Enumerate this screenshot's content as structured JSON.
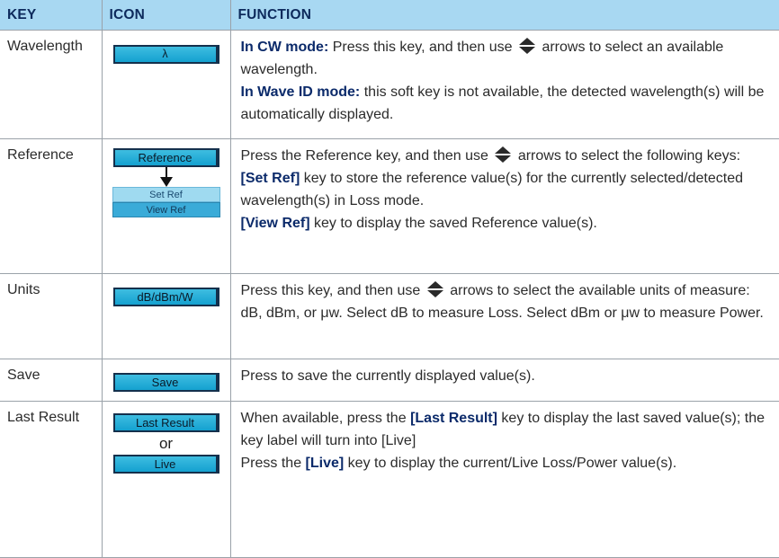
{
  "header": {
    "key": "KEY",
    "icon": "ICON",
    "function": "FUNCTION"
  },
  "colors": {
    "header_bg": "#a8d8f2",
    "header_text": "#0d2a5c",
    "softkey": "#1fa8d6",
    "border": "#9aa2a9"
  },
  "rows": [
    {
      "key": "Wavelength",
      "icon": {
        "button": "λ"
      },
      "function": {
        "p1_bold": "In CW mode:",
        "p1_a": "Press this key, and then use",
        "p1_b": "arrows to select an available wavelength.",
        "p2_bold": "In Wave ID mode:",
        "p2_text": "this soft key is not available, the detected wavelength(s) will be automatically displayed."
      }
    },
    {
      "key": "Reference",
      "icon": {
        "button": "Reference",
        "sub1": "Set Ref",
        "sub2": "View Ref"
      },
      "function": {
        "p1_a": "Press the Reference key, and then use",
        "p1_b": "arrows to select the following keys:",
        "p2_bold": "[Set Ref]",
        "p2_text": "key to store the reference value(s) for the currently selected/detected wavelength(s) in Loss mode.",
        "p3_bold": "[View Ref]",
        "p3_text": "key to display the saved Reference value(s)."
      }
    },
    {
      "key": "Units",
      "icon": {
        "button": "dB/dBm/W"
      },
      "function": {
        "p1_a": "Press this key, and then use",
        "p1_b": "arrows to select the available units of measure: dB, dBm, or μw. Select dB to measure Loss. Select dBm or μw to measure Power."
      }
    },
    {
      "key": "Save",
      "icon": {
        "button": "Save"
      },
      "function": {
        "p1": "Press to save the currently displayed value(s)."
      }
    },
    {
      "key": "Last Result",
      "icon": {
        "button": "Last Result",
        "or": "or",
        "button2": "Live"
      },
      "function": {
        "p1_a": "When available, press the",
        "p1_bold": "[Last Result]",
        "p1_b": "key to display the last saved value(s); the key label will turn into [Live]",
        "p2_a": "Press the",
        "p2_bold": "[Live]",
        "p2_b": "key to display the current/Live Loss/Power value(s)."
      }
    }
  ]
}
